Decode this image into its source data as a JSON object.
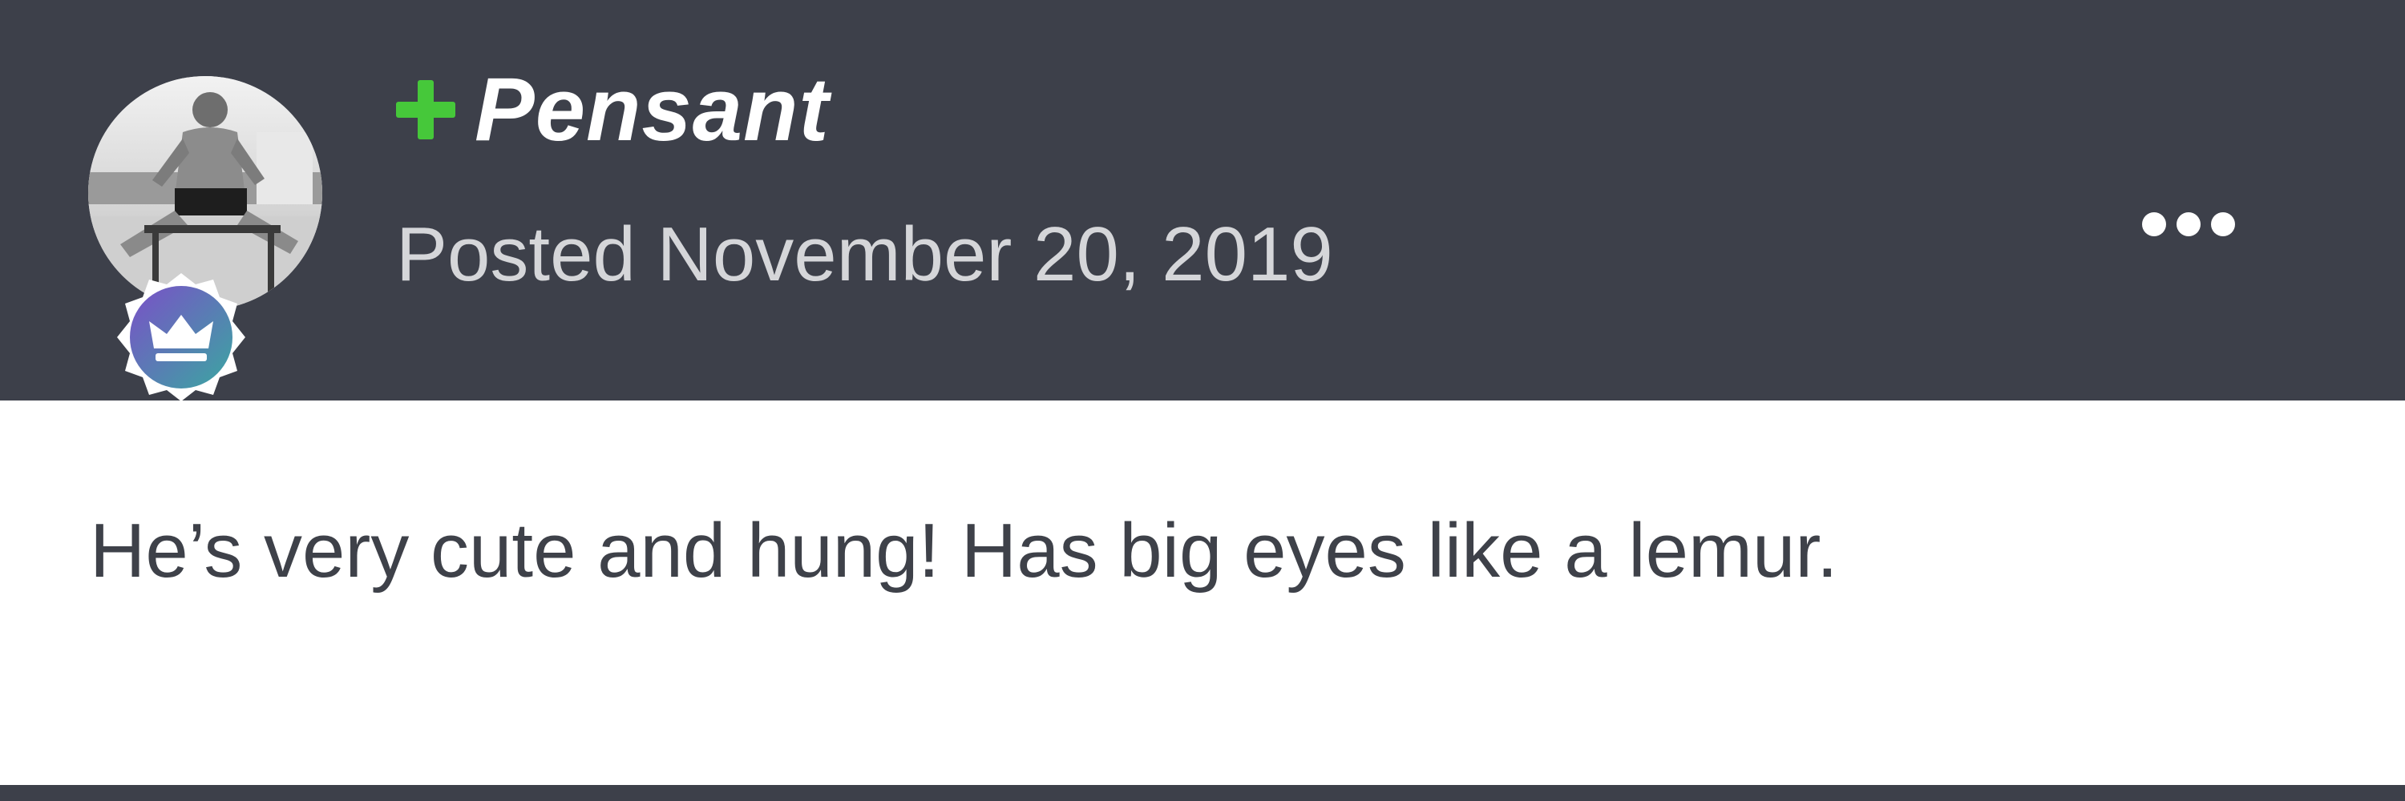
{
  "post": {
    "author": {
      "name": "Pensant",
      "avatar": "avatar-photo",
      "badge_icon": "crown-icon",
      "badge_color": "#6a56b3",
      "prefix_icon": "plus-icon",
      "prefix_color": "#46c83a"
    },
    "date_text": "Posted November 20, 2019",
    "more_icon": "ellipsis-icon",
    "body_text": "He’s very cute and hung! Has big eyes like a lemur."
  },
  "colors": {
    "header_bg": "#3d404a",
    "body_bg": "#ffffff",
    "body_text": "#3e4149"
  }
}
